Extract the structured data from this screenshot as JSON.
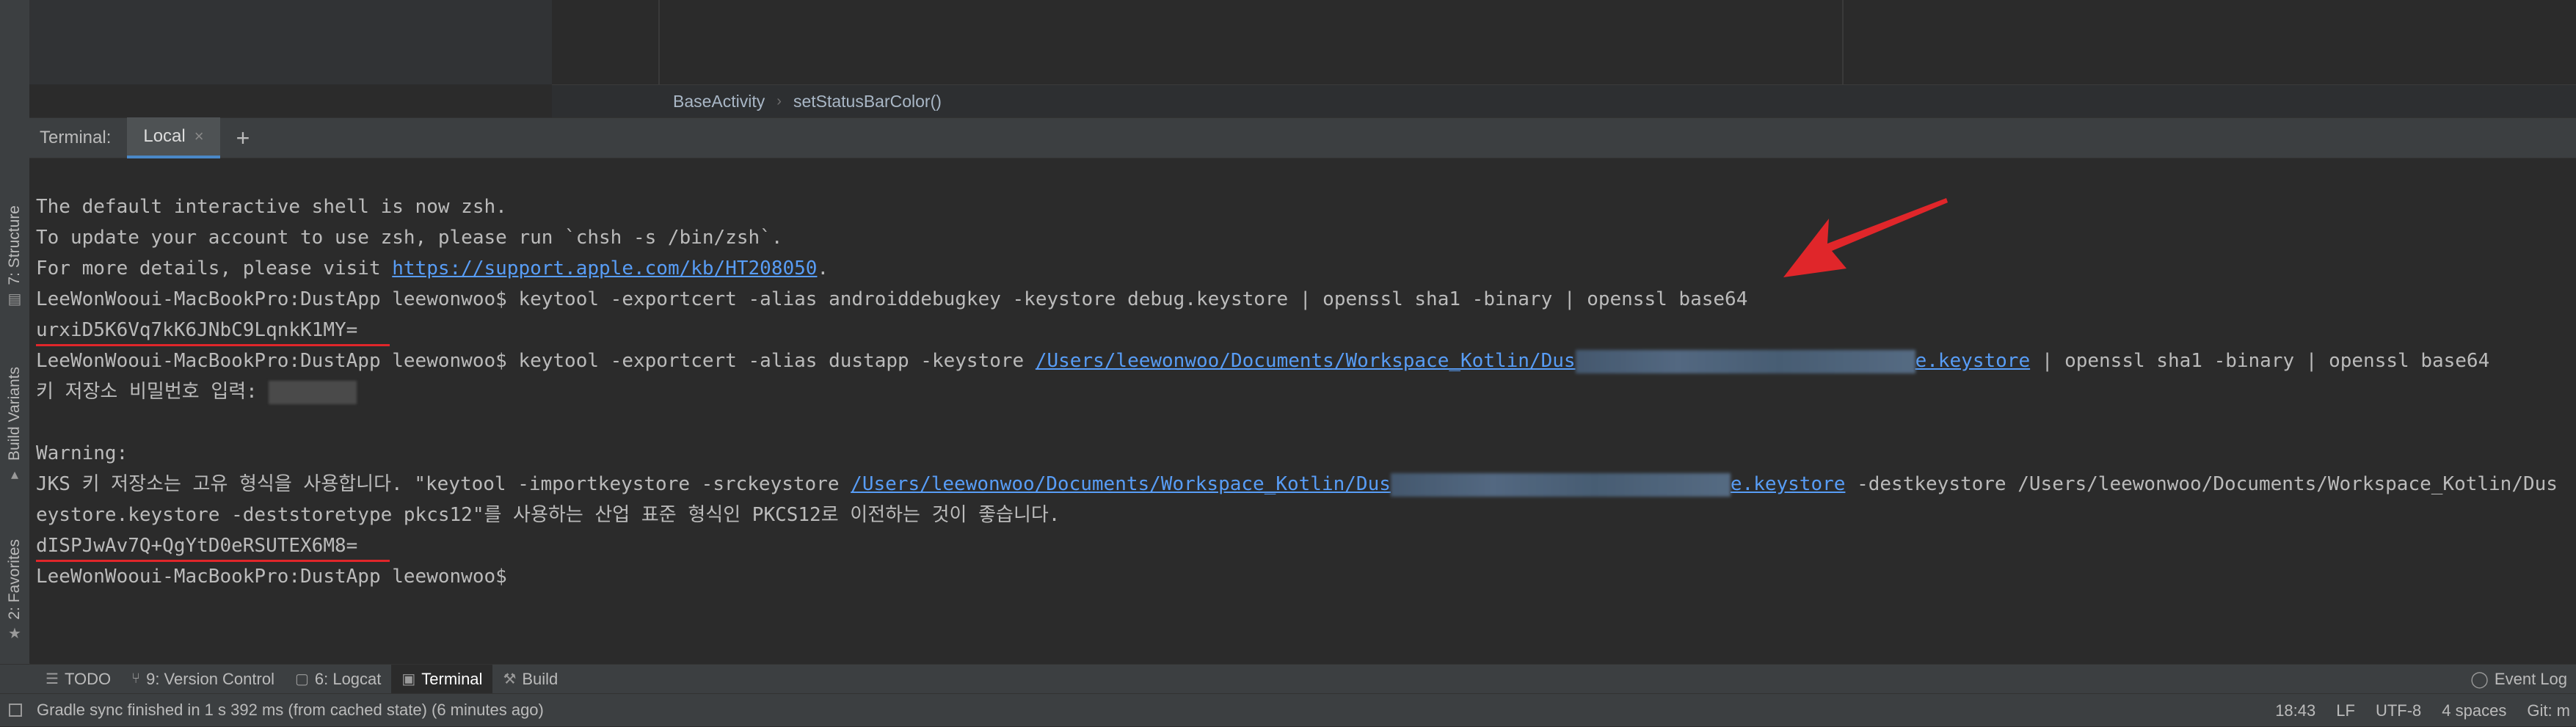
{
  "left_strip": {
    "structure_label": "7: Structure",
    "build_variants_label": "Build Variants",
    "favorites_label": "2: Favorites"
  },
  "breadcrumb": {
    "items": [
      "BaseActivity",
      "setStatusBarColor()"
    ]
  },
  "terminal": {
    "title": "Terminal:",
    "tab_label": "Local",
    "add_tab": "+",
    "lines": {
      "l1": "The default interactive shell is now zsh.",
      "l2": "To update your account to use zsh, please run `chsh -s /bin/zsh`.",
      "l3_prefix": "For more details, please visit ",
      "l3_link": "https://support.apple.com/kb/HT208050",
      "l3_suffix": ".",
      "l4": "LeeWonWooui-MacBookPro:DustApp leewonwoo$ keytool -exportcert -alias androiddebugkey -keystore debug.keystore | openssl sha1 -binary | openssl base64",
      "l5": "urxiD5K6Vq7kK6JNbC9LqnkK1MY=",
      "l6_prefix": "LeeWonWooui-MacBookPro:DustApp leewonwoo$ keytool -exportcert -alias dustapp -keystore ",
      "l6_link_a": "/Users/leewonwoo/Documents/Workspace_Kotlin/Dus",
      "l6_link_b": "e.keystore",
      "l6_suffix": " | openssl sha1 -binary | openssl base64",
      "l7": "키 저장소 비밀번호 입력: ",
      "l9": "Warning:",
      "l10_prefix": "JKS 키 저장소는 고유 형식을 사용합니다. \"keytool -importkeystore -srckeystore ",
      "l10_link_a": "/Users/leewonwoo/Documents/Workspace_Kotlin/Dus",
      "l10_link_b": "e.keystore",
      "l10_suffix": " -destkeystore /Users/leewonwoo/Documents/Workspace_Kotlin/Dus",
      "l11": "eystore.keystore -deststoretype pkcs12\"를 사용하는 산업 표준 형식인 PKCS12로 이전하는 것이 좋습니다.",
      "l12": "dISPJwAv7Q+QgYtD0eRSUTEX6M8=",
      "l13": "LeeWonWooui-MacBookPro:DustApp leewonwoo$ "
    }
  },
  "bottom_tabs": {
    "todo": "TODO",
    "version_control": "9: Version Control",
    "logcat": "6: Logcat",
    "terminal": "Terminal",
    "build": "Build",
    "event_log": "Event Log"
  },
  "status_bar": {
    "message": "Gradle sync finished in 1 s 392 ms (from cached state) (6 minutes ago)",
    "position": "18:43",
    "line_sep": "LF",
    "encoding": "UTF-8",
    "indent": "4 spaces",
    "git": "Git: m"
  },
  "colors": {
    "annotation_red": "#e0262a",
    "link_blue": "#589df6",
    "active_tab_underline": "#4a88c7"
  }
}
